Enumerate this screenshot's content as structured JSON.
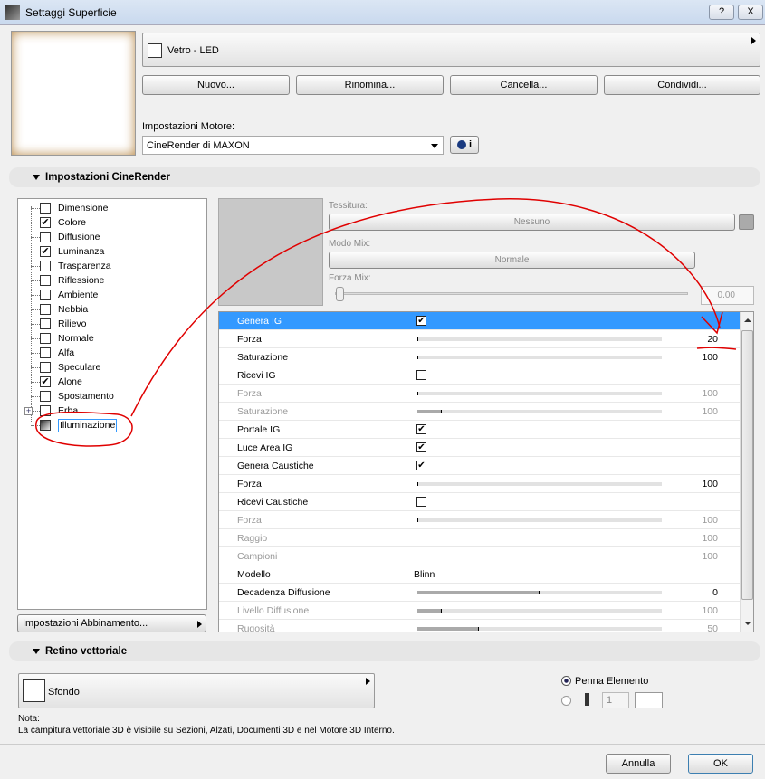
{
  "window": {
    "title": "Settaggi Superficie",
    "help": "?",
    "close": "X"
  },
  "material": {
    "name": "Vetro - LED",
    "buttons": [
      "Nuovo...",
      "Rinomina...",
      "Cancella...",
      "Condividi..."
    ]
  },
  "engine": {
    "label": "Impostazioni Motore:",
    "value": "CineRender di MAXON",
    "info": "i"
  },
  "cinerender": {
    "header": "Impostazioni CineRender",
    "channels": [
      {
        "label": "Dimensione",
        "checked": false
      },
      {
        "label": "Colore",
        "checked": true
      },
      {
        "label": "Diffusione",
        "checked": false
      },
      {
        "label": "Luminanza",
        "checked": true
      },
      {
        "label": "Trasparenza",
        "checked": false
      },
      {
        "label": "Riflessione",
        "checked": false
      },
      {
        "label": "Ambiente",
        "checked": false
      },
      {
        "label": "Nebbia",
        "checked": false
      },
      {
        "label": "Rilievo",
        "checked": false
      },
      {
        "label": "Normale",
        "checked": false
      },
      {
        "label": "Alfa",
        "checked": false
      },
      {
        "label": "Speculare",
        "checked": false
      },
      {
        "label": "Alone",
        "checked": true
      },
      {
        "label": "Spostamento",
        "checked": false
      },
      {
        "label": "Erba",
        "checked": false
      },
      {
        "label": "Illuminazione",
        "checked": false
      }
    ],
    "match_button": "Impostazioni Abbinamento...",
    "texture_label": "Tessitura:",
    "texture_value": "Nessuno",
    "mix_mode_label": "Modo Mix:",
    "mix_mode_value": "Normale",
    "mix_strength_label": "Forza Mix:",
    "mix_strength_value": "0.00",
    "properties": [
      {
        "name": "Genera IG",
        "type": "check",
        "checked": true,
        "selected": true
      },
      {
        "name": "Forza",
        "type": "slider",
        "fraction": 0,
        "value": "20"
      },
      {
        "name": "Saturazione",
        "type": "slider",
        "fraction": 0,
        "value": "100"
      },
      {
        "name": "Ricevi IG",
        "type": "check",
        "checked": false
      },
      {
        "name": "Forza",
        "type": "slider",
        "fraction": 0,
        "value": "100",
        "disabled": true
      },
      {
        "name": "Saturazione",
        "type": "slider",
        "fraction": 0.1,
        "value": "100",
        "disabled": true
      },
      {
        "name": "Portale IG",
        "type": "check",
        "checked": true
      },
      {
        "name": "Luce Area IG",
        "type": "check",
        "checked": true
      },
      {
        "name": "Genera Caustiche",
        "type": "check",
        "checked": true
      },
      {
        "name": "Forza",
        "type": "slider",
        "fraction": 0,
        "value": "100"
      },
      {
        "name": "Ricevi Caustiche",
        "type": "check",
        "checked": false
      },
      {
        "name": "Forza",
        "type": "slider",
        "fraction": 0,
        "value": "100",
        "disabled": true
      },
      {
        "name": "Raggio",
        "type": "value",
        "value": "100",
        "disabled": true
      },
      {
        "name": "Campioni",
        "type": "value",
        "value": "100",
        "disabled": true
      },
      {
        "name": "Modello",
        "type": "text",
        "value": "Blinn"
      },
      {
        "name": "Decadenza Diffusione",
        "type": "slider",
        "fraction": 0.5,
        "value": "0"
      },
      {
        "name": "Livello Diffusione",
        "type": "slider",
        "fraction": 0.1,
        "value": "100",
        "disabled": true
      },
      {
        "name": "Rugosità",
        "type": "slider",
        "fraction": 0.25,
        "value": "50",
        "disabled": true
      }
    ]
  },
  "vector": {
    "header": "Retino vettoriale",
    "fill": "Sfondo",
    "pen_label": "Penna Elemento",
    "pen_value": "1",
    "note_label": "Nota:",
    "note": "La campitura vettoriale 3D è visibile su Sezioni, Alzati, Documenti 3D e nel Motore 3D Interno."
  },
  "footer": {
    "cancel": "Annulla",
    "ok": "OK"
  },
  "colors": {
    "selection": "#3399ff",
    "annotation": "#e00000"
  }
}
